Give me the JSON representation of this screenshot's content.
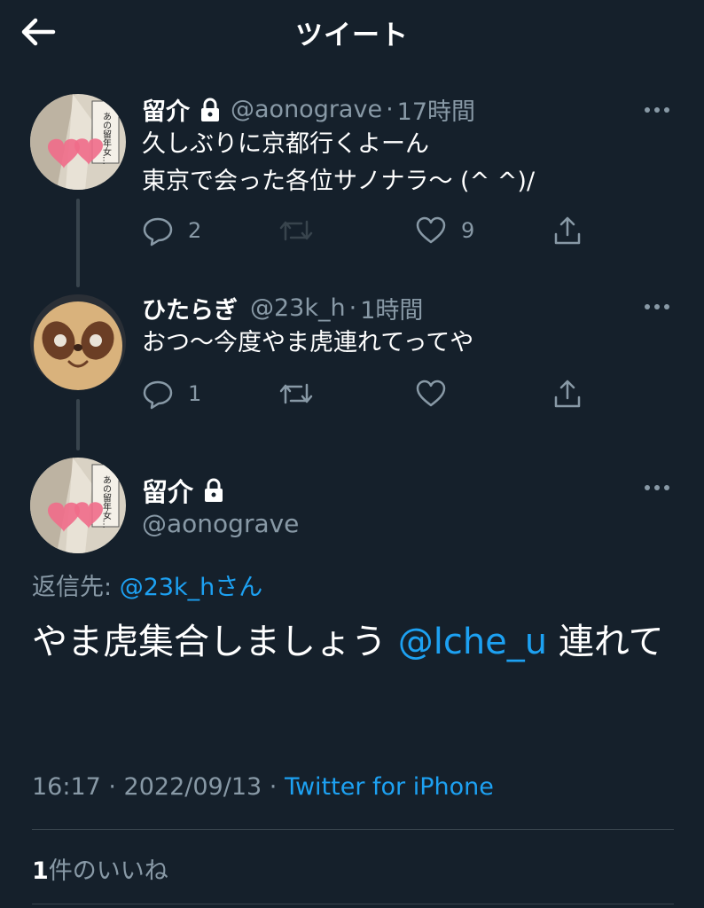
{
  "header": {
    "title": "ツイート"
  },
  "tweets": [
    {
      "name": "留介",
      "handle": "@aonograve",
      "time": "17時間",
      "text": "久しぶりに京都行くよーん\n東京で会った各位サノナラ〜 (^ ^)/",
      "replies": "2",
      "retweets": "",
      "likes": "9"
    },
    {
      "name": "ひたらぎ",
      "handle": "@23k_h",
      "time": "1時間",
      "text": "おつ〜今度やま虎連れてってや",
      "replies": "1",
      "retweets": "",
      "likes": ""
    }
  ],
  "main": {
    "name": "留介",
    "handle": "@aonograve",
    "reply_prefix": "返信先: ",
    "reply_mention": "@23k_hさん",
    "text_before": "やま虎集合しましょう ",
    "text_mention": "@lche_u",
    "text_after": " 連れて",
    "timestamp": "16:17 · 2022/09/13 · ",
    "source": "Twitter for iPhone",
    "likes_count": "1",
    "likes_label": "件のいいね"
  },
  "avatar_text": "あの留年女…",
  "colors": {
    "background": "#15202b",
    "secondary": "#8899a6",
    "accent": "#1da1f2",
    "border": "#38444d"
  },
  "icons": [
    "back-arrow-icon",
    "lock-icon",
    "more-icon",
    "reply-icon",
    "retweet-icon",
    "like-icon",
    "share-icon"
  ]
}
